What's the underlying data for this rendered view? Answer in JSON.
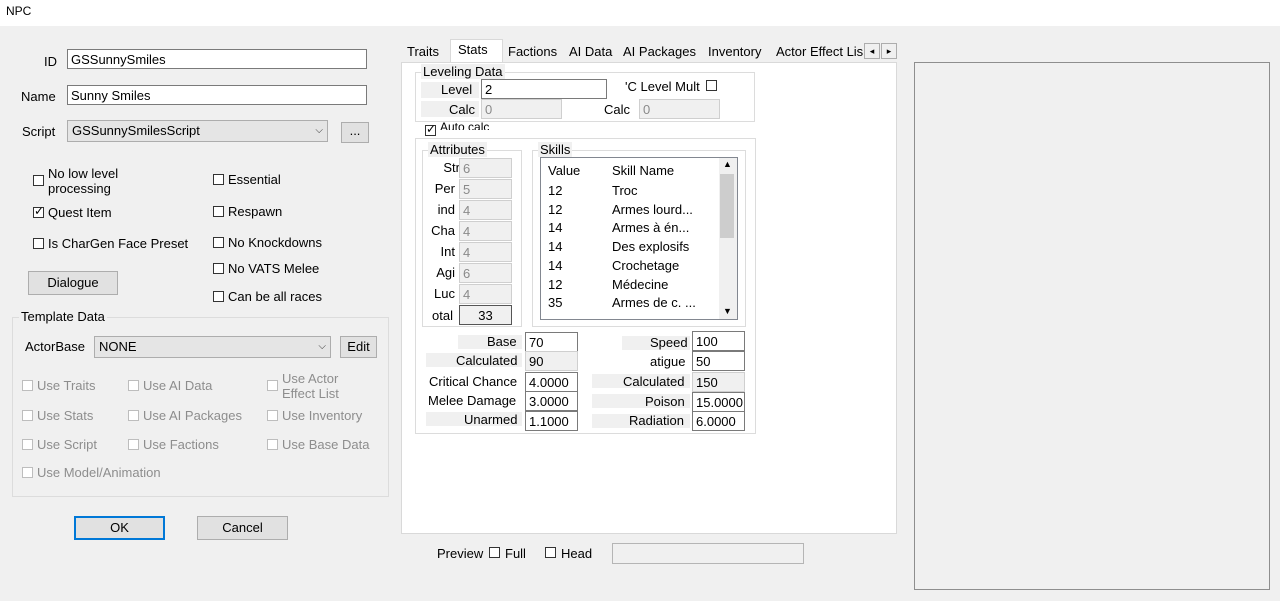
{
  "window": {
    "title": "NPC"
  },
  "form": {
    "id_label": "ID",
    "id_value": "GSSunnySmiles",
    "name_label": "Name",
    "name_value": "Sunny Smiles",
    "script_label": "Script",
    "script_value": "GSSunnySmilesScript",
    "script_browse": "..."
  },
  "flags": {
    "no_low_level": "No low level\nprocessing",
    "essential": "Essential",
    "quest_item": "Quest Item",
    "respawn": "Respawn",
    "chargen": "Is CharGen Face Preset",
    "no_knockdowns": "No Knockdowns",
    "no_vats": "No VATS Melee",
    "all_races": "Can be all races"
  },
  "dialogue_button": "Dialogue",
  "template": {
    "title": "Template Data",
    "actorbase_label": "ActorBase",
    "actorbase_value": "NONE",
    "edit_button": "Edit",
    "use_traits": "Use Traits",
    "use_ai_data": "Use AI Data",
    "use_actor_effect": "Use Actor\nEffect List",
    "use_stats": "Use Stats",
    "use_ai_packages": "Use AI Packages",
    "use_inventory": "Use Inventory",
    "use_script": "Use Script",
    "use_factions": "Use Factions",
    "use_base_data": "Use Base Data",
    "use_model": "Use Model/Animation"
  },
  "buttons": {
    "ok": "OK",
    "cancel": "Cancel"
  },
  "tabs": [
    "Traits",
    "Stats",
    "Factions",
    "AI Data",
    "AI Packages",
    "Inventory",
    "Actor Effect Lis"
  ],
  "tab_scroll": {
    "left": "◂",
    "right": "▸"
  },
  "leveling": {
    "title": "Leveling Data",
    "level_label": "Level",
    "level_value": "2",
    "pc_level_mult": "'C Level Mult",
    "calc_label": "Calc",
    "calc1_value": "0",
    "calc2_value": "0",
    "auto_calc": "Auto calc"
  },
  "attributes": {
    "title": "Attributes",
    "items": [
      {
        "label": "Str",
        "value": "6"
      },
      {
        "label": "Per",
        "value": "5"
      },
      {
        "label": "ind",
        "value": "4"
      },
      {
        "label": "Cha",
        "value": "4"
      },
      {
        "label": "Int",
        "value": "4"
      },
      {
        "label": "Agi",
        "value": "6"
      },
      {
        "label": "Luc",
        "value": "4"
      }
    ],
    "total_label": "otal",
    "total_value": "33"
  },
  "skills": {
    "title": "Skills",
    "col_value": "Value",
    "col_name": "Skill Name",
    "rows": [
      {
        "value": "12",
        "name": "Troc"
      },
      {
        "value": "12",
        "name": "Armes lourd..."
      },
      {
        "value": "14",
        "name": "Armes à én..."
      },
      {
        "value": "14",
        "name": "Des explosifs"
      },
      {
        "value": "14",
        "name": "Crochetage"
      },
      {
        "value": "12",
        "name": "Médecine"
      },
      {
        "value": "35",
        "name": "Armes de c. ..."
      }
    ]
  },
  "health": {
    "base_label": "Base",
    "base_value": "70",
    "calculated_label": "Calculated",
    "calculated_value": "90",
    "critical_label": "Critical Chance",
    "critical_value": "4.0000",
    "melee_label": "Melee Damage",
    "melee_value": "3.0000",
    "unarmed_label": "Unarmed",
    "unarmed_value": "1.1000",
    "speed_label": "Speed",
    "speed_value": "100",
    "fatigue_label": "atigue",
    "fatigue_value": "50",
    "fatigue_calc_label": "Calculated",
    "fatigue_calc_value": "150",
    "poison_label": "Poison",
    "poison_value": "15.0000",
    "radiation_label": "Radiation",
    "radiation_value": "6.0000"
  },
  "preview": {
    "label": "Preview",
    "full": "Full",
    "head": "Head"
  }
}
